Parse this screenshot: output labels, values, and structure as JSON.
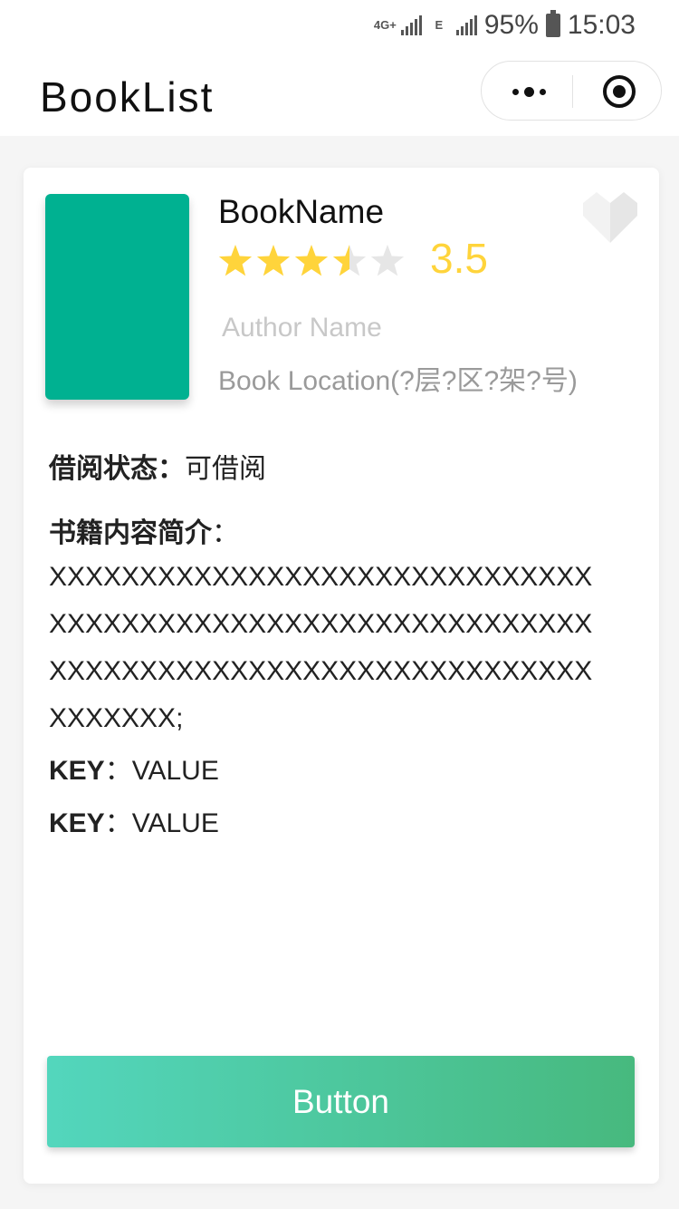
{
  "status_bar": {
    "network": "4G+",
    "network_secondary": "E",
    "battery": "95%",
    "time": "15:03"
  },
  "header": {
    "title": "BookList",
    "more_icon": "more-dots-icon",
    "close_icon": "target-circle-icon"
  },
  "book": {
    "name": "BookName",
    "rating": "3.5",
    "rating_fraction": 0.7,
    "stars_total": 5,
    "author": "Author Name",
    "location": "Book Location(?层?区?架?号)",
    "cover_color": "#00b191",
    "favorite_icon": "heart-icon"
  },
  "details": {
    "status_label": "借阅状态：",
    "status_value": "可借阅",
    "description_label": "书籍内容简介",
    "description_colon": "：",
    "description_text": "XXXXXXXXXXXXXXXXXXXXXXXXXXXXXXXXXXXXXXXXXXXXXXXXXXXXXXXXXXXXXXXXXXXXXXXXXXXXXXXXXXXXXXXXXXXXXXXXX;",
    "fields": [
      {
        "key": "KEY",
        "sep": "：",
        "value": "VALUE"
      },
      {
        "key": "KEY",
        "sep": "：",
        "value": "VALUE"
      }
    ]
  },
  "action": {
    "button_label": "Button"
  },
  "colors": {
    "star_on": "#ffd43b",
    "star_off": "#e6e6e6",
    "rating_text": "#ffd43b",
    "button_start": "#53d6bd",
    "button_end": "#47b97e"
  }
}
